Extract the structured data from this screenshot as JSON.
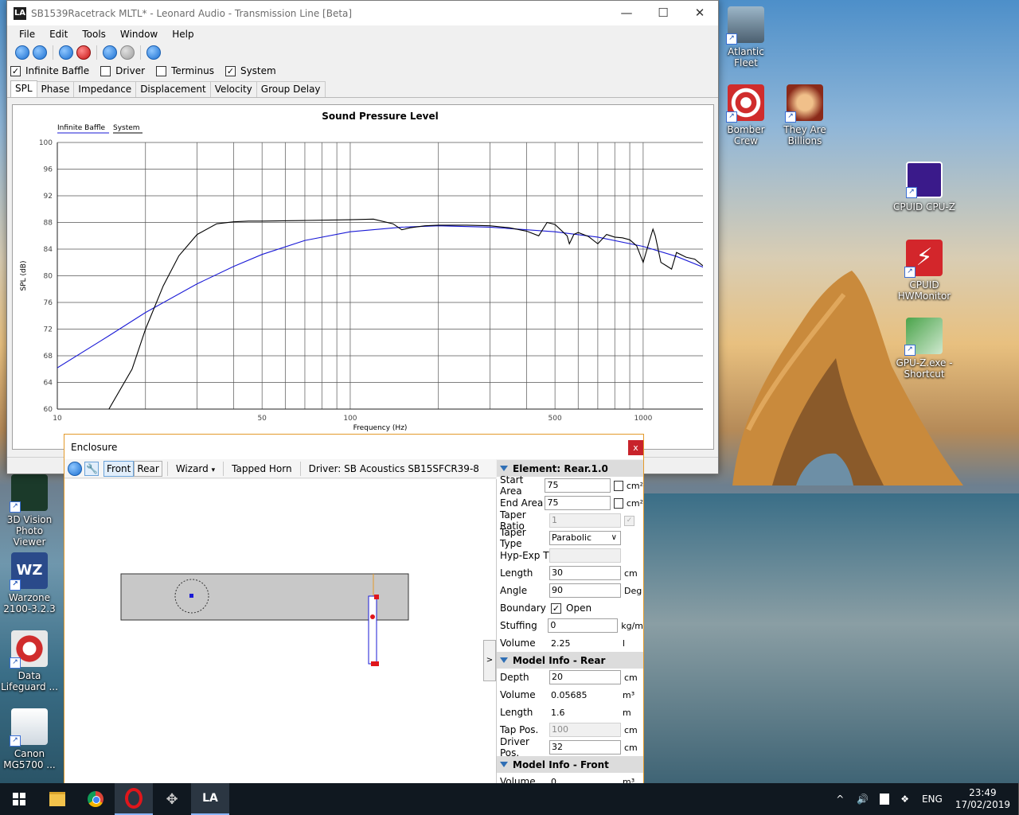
{
  "desktop": {
    "icons_right": [
      {
        "label": "Atlantic Fleet",
        "icon": "ship-icon"
      },
      {
        "label": "Bomber Crew",
        "icon": "target-icon"
      },
      {
        "label": "They Are Billions",
        "icon": "skull-icon"
      },
      {
        "label": "CPUID CPU-Z",
        "icon": "cpu-icon"
      },
      {
        "label": "CPUID HWMonitor",
        "icon": "lightning-icon"
      },
      {
        "label": "GPU-Z.exe - Shortcut",
        "icon": "gpu-icon"
      }
    ],
    "icons_left": [
      {
        "label": "3D Vision Photo Viewer",
        "icon": "eagle-icon"
      },
      {
        "label": "Warzone 2100-3.2.3",
        "icon": "wz-icon"
      },
      {
        "label": "Data Lifeguard ...",
        "icon": "lifebuoy-icon"
      },
      {
        "label": "Canon MG5700 ...",
        "icon": "document-icon"
      }
    ]
  },
  "main_window": {
    "title": "SB1539Racetrack MLTL* - Leonard Audio - Transmission Line [Beta]",
    "app_icon_text": "LA",
    "controls": {
      "minimize": "—",
      "maximize": "☐",
      "close": "✕"
    },
    "menu": [
      "File",
      "Edit",
      "Tools",
      "Window",
      "Help"
    ],
    "checkboxes": [
      {
        "label": "Infinite Baffle",
        "checked": true
      },
      {
        "label": "Driver",
        "checked": false
      },
      {
        "label": "Terminus",
        "checked": false
      },
      {
        "label": "System",
        "checked": true
      }
    ],
    "tabs": [
      "SPL",
      "Phase",
      "Impedance",
      "Displacement",
      "Velocity",
      "Group Delay"
    ],
    "active_tab": "SPL"
  },
  "chart_data": {
    "type": "line",
    "title": "Sound Pressure Level",
    "xlabel": "Frequency (Hz)",
    "ylabel": "SPL (dB)",
    "x_scale": "log",
    "xlim": [
      10,
      1600
    ],
    "ylim": [
      60,
      100
    ],
    "x_ticks": [
      "10",
      "50",
      "100",
      "500",
      "1000"
    ],
    "y_ticks": [
      "100",
      "96",
      "92",
      "88",
      "84",
      "80",
      "76",
      "72",
      "68",
      "64",
      "60"
    ],
    "grid": true,
    "legend": [
      "Infinite Baffle",
      "System"
    ],
    "legend_position": "top-left",
    "series": [
      {
        "name": "Infinite Baffle",
        "color": "#1a1ad6",
        "x": [
          10,
          15,
          20,
          30,
          40,
          50,
          70,
          100,
          150,
          200,
          300,
          400,
          500,
          700,
          1000,
          1300,
          1600
        ],
        "y": [
          66.2,
          71.0,
          74.5,
          78.8,
          81.4,
          83.2,
          85.3,
          86.6,
          87.3,
          87.5,
          87.3,
          86.9,
          86.6,
          85.8,
          84.4,
          82.9,
          81.3
        ]
      },
      {
        "name": "System",
        "color": "#000000",
        "x": [
          15,
          18,
          20,
          23,
          26,
          30,
          35,
          40,
          45,
          50,
          70,
          100,
          120,
          140,
          150,
          160,
          180,
          200,
          250,
          300,
          350,
          400,
          440,
          470,
          500,
          550,
          560,
          580,
          600,
          650,
          700,
          750,
          800,
          850,
          900,
          950,
          1000,
          1050,
          1080,
          1100,
          1150,
          1200,
          1250,
          1300,
          1400,
          1500,
          1600
        ],
        "y": [
          60.0,
          66.0,
          72.0,
          78.5,
          83.0,
          86.2,
          87.8,
          88.1,
          88.2,
          88.2,
          88.3,
          88.4,
          88.5,
          87.8,
          86.9,
          87.2,
          87.5,
          87.6,
          87.6,
          87.5,
          87.2,
          86.7,
          86.0,
          88.0,
          87.7,
          86.0,
          84.8,
          86.2,
          86.5,
          85.9,
          84.8,
          86.2,
          85.8,
          85.7,
          85.4,
          84.5,
          82.0,
          85.2,
          87.0,
          86.0,
          82.0,
          81.5,
          81.0,
          83.5,
          82.8,
          82.5,
          81.5
        ]
      }
    ]
  },
  "enclosure": {
    "title": "Enclosure",
    "close": "x",
    "toolbar": {
      "front": "Front",
      "rear": "Rear",
      "wizard": "Wizard",
      "wizard_arrow": "▾",
      "mode": "Tapped Horn",
      "driver": "Driver: SB Acoustics SB15SFCR39-8"
    },
    "collapse_arrow": ">",
    "element_section": "Element: Rear.1.0",
    "element_props": [
      {
        "label": "Start Area",
        "value": "75",
        "unit": "cm²",
        "kind": "input",
        "checkbox": true
      },
      {
        "label": "End Area",
        "value": "75",
        "unit": "cm²",
        "kind": "input",
        "checkbox": true
      },
      {
        "label": "Taper Ratio",
        "value": "1",
        "unit": "",
        "kind": "disabled",
        "checkbox": true
      },
      {
        "label": "Taper Type",
        "value": "Parabolic",
        "unit": "",
        "kind": "select"
      },
      {
        "label": "Hyp-Exp T",
        "value": "",
        "unit": "",
        "kind": "disabled"
      },
      {
        "label": "Length",
        "value": "30",
        "unit": "cm",
        "kind": "input"
      },
      {
        "label": "Angle",
        "value": "90",
        "unit": "Deg",
        "kind": "input"
      },
      {
        "label": "Boundary",
        "value": "Open",
        "unit": "",
        "kind": "checkbox"
      },
      {
        "label": "Stuffing",
        "value": "0",
        "unit": "kg/m",
        "kind": "input"
      },
      {
        "label": "Volume",
        "value": "2.25",
        "unit": "l",
        "kind": "text"
      }
    ],
    "model_rear_section": "Model Info - Rear",
    "model_rear_props": [
      {
        "label": "Depth",
        "value": "20",
        "unit": "cm",
        "kind": "input"
      },
      {
        "label": "Volume",
        "value": "0.05685",
        "unit": "m³",
        "kind": "text"
      },
      {
        "label": "Length",
        "value": "1.6",
        "unit": "m",
        "kind": "text"
      },
      {
        "label": "Tap Pos.",
        "value": "100",
        "unit": "cm",
        "kind": "disabled"
      },
      {
        "label": "Driver Pos.",
        "value": "32",
        "unit": "cm",
        "kind": "input"
      }
    ],
    "model_front_section": "Model Info - Front",
    "model_front_props": [
      {
        "label": "Volume",
        "value": "0",
        "unit": "m³",
        "kind": "text"
      }
    ]
  },
  "taskbar": {
    "apps": [
      "start-icon",
      "file-explorer-icon",
      "chrome-icon",
      "opera-icon",
      "game-icon",
      "leonard-audio-icon"
    ],
    "tray": {
      "lang": "ENG",
      "time": "23:49",
      "date": "17/02/2019",
      "chevron": "^"
    }
  }
}
